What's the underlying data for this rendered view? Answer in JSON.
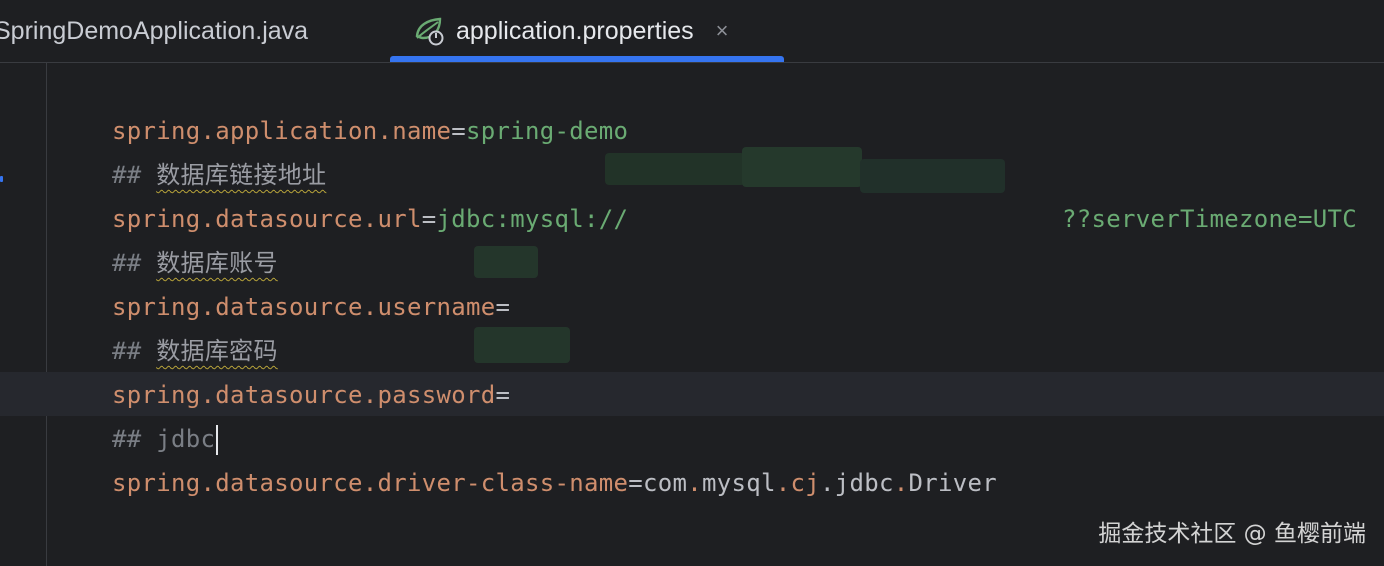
{
  "tabs": [
    {
      "label": "SpringDemoApplication.java",
      "active": false
    },
    {
      "label": "application.properties",
      "active": true,
      "close": "×"
    }
  ],
  "editor": {
    "lines": [
      {
        "key": "spring.application.name",
        "eq": "=",
        "value": "spring-demo"
      },
      {
        "comment_prefix": "## ",
        "comment_text": "数据库链接地址"
      },
      {
        "key": "spring.datasource.url",
        "eq": "=",
        "value_start": "jdbc:mysql://",
        "value_end": "??serverTimezone=UTC"
      },
      {
        "comment_prefix": "## ",
        "comment_text": "数据库账号"
      },
      {
        "key": "spring.datasource.username",
        "eq": "="
      },
      {
        "comment_prefix": "## ",
        "comment_text": "数据库密码"
      },
      {
        "key": "spring.datasource.password",
        "eq": "="
      },
      {
        "comment_prefix": "## ",
        "comment_text": "jdbc"
      },
      {
        "key": "spring.datasource.driver-class-name",
        "eq": "=",
        "value_parts": [
          "com",
          ".",
          "mysql",
          ".",
          "cj",
          ".",
          "jdbc",
          ".",
          "Driver"
        ]
      }
    ]
  },
  "watermark": "掘金技术社区 @ 鱼樱前端",
  "colors": {
    "background": "#1e1f22",
    "key": "#cf8e6d",
    "string_value": "#6aab73",
    "comment": "#7a7e85",
    "accent": "#3574f0"
  },
  "icons": {
    "tab_icon": "spring-leaf-icon",
    "close": "close-icon"
  }
}
